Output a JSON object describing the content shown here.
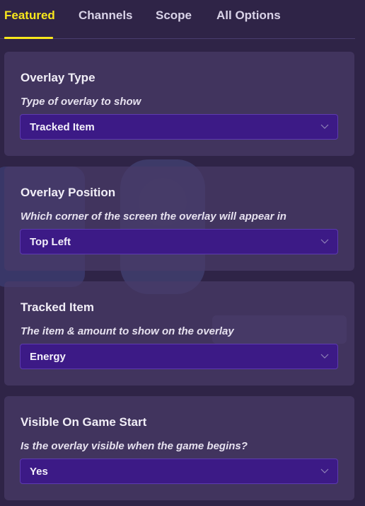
{
  "tabs": [
    {
      "label": "Featured",
      "active": true
    },
    {
      "label": "Channels",
      "active": false
    },
    {
      "label": "Scope",
      "active": false
    },
    {
      "label": "All Options",
      "active": false
    }
  ],
  "options": [
    {
      "title": "Overlay Type",
      "description": "Type of overlay to show",
      "value": "Tracked Item"
    },
    {
      "title": "Overlay Position",
      "description": "Which corner of the screen the overlay will appear in",
      "value": "Top Left"
    },
    {
      "title": "Tracked Item",
      "description": "The item & amount to show on the overlay",
      "value": "Energy"
    },
    {
      "title": "Visible On Game Start",
      "description": "Is the overlay visible when the game begins?",
      "value": "Yes"
    }
  ],
  "colors": {
    "background": "#2f2447",
    "accent": "#f8e71c",
    "select_bg": "#3c1a86"
  },
  "icons": {
    "dropdown": "chevron-down-icon"
  }
}
